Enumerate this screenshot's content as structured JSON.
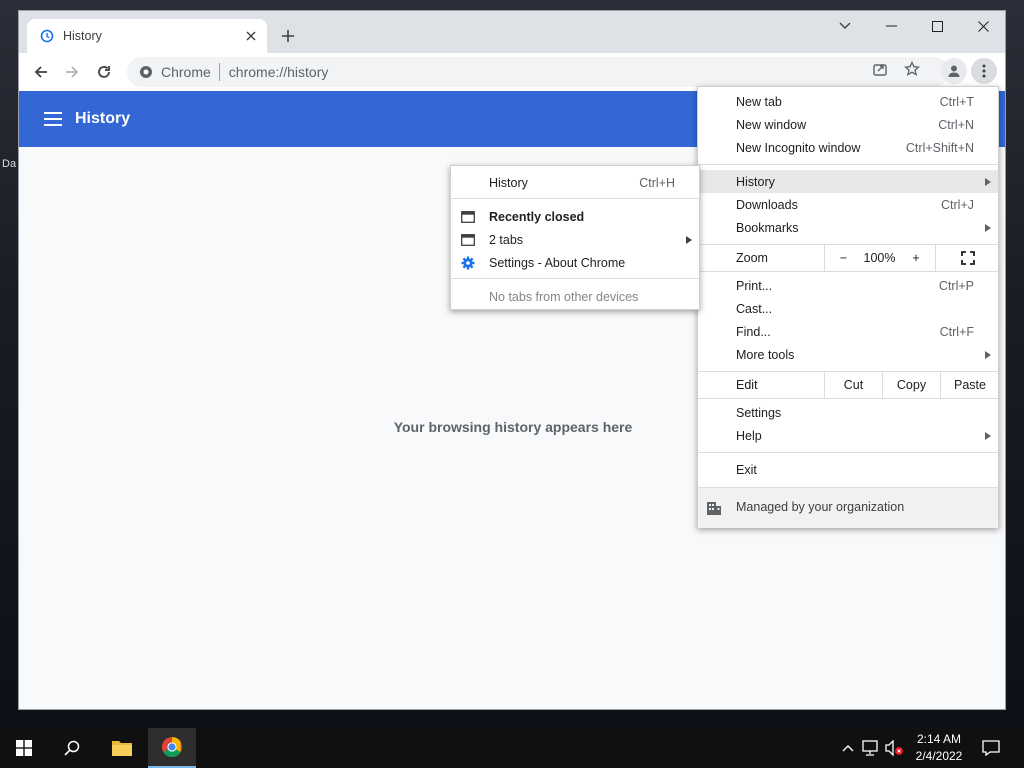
{
  "desktop": {
    "label_da": "Da"
  },
  "tab": {
    "title": "History"
  },
  "omnibox": {
    "chip": "Chrome",
    "url": "chrome://history"
  },
  "header": {
    "title": "History"
  },
  "empty": {
    "message": "Your browsing history appears here"
  },
  "main_menu": {
    "new_tab": {
      "label": "New tab",
      "shortcut": "Ctrl+T"
    },
    "new_window": {
      "label": "New window",
      "shortcut": "Ctrl+N"
    },
    "new_incognito": {
      "label": "New Incognito window",
      "shortcut": "Ctrl+Shift+N"
    },
    "history": {
      "label": "History"
    },
    "downloads": {
      "label": "Downloads",
      "shortcut": "Ctrl+J"
    },
    "bookmarks": {
      "label": "Bookmarks"
    },
    "zoom": {
      "label": "Zoom",
      "minus": "−",
      "value": "100%",
      "plus": "+"
    },
    "print": {
      "label": "Print...",
      "shortcut": "Ctrl+P"
    },
    "cast": {
      "label": "Cast..."
    },
    "find": {
      "label": "Find...",
      "shortcut": "Ctrl+F"
    },
    "more_tools": {
      "label": "More tools"
    },
    "edit": {
      "label": "Edit",
      "cut": "Cut",
      "copy": "Copy",
      "paste": "Paste"
    },
    "settings": {
      "label": "Settings"
    },
    "help": {
      "label": "Help"
    },
    "exit": {
      "label": "Exit"
    },
    "managed": {
      "label": "Managed by your organization"
    }
  },
  "history_submenu": {
    "history": {
      "label": "History",
      "shortcut": "Ctrl+H"
    },
    "recently_closed": {
      "label": "Recently closed"
    },
    "two_tabs": {
      "label": "2 tabs"
    },
    "settings_about": {
      "label": "Settings - About Chrome"
    },
    "no_tabs": {
      "label": "No tabs from other devices"
    }
  },
  "taskbar": {
    "time": "2:14 AM",
    "date": "2/4/2022"
  },
  "colors": {
    "accent": "#3367d6",
    "tab_strip": "#dee1e6",
    "page_bg": "#f8f9fa",
    "taskbar": "#101010"
  },
  "icons": [
    "history-icon",
    "close-icon",
    "plus-icon",
    "chevron-down-icon",
    "minimize-icon",
    "maximize-icon",
    "back-icon",
    "forward-icon",
    "reload-icon",
    "share-icon",
    "star-icon",
    "profile-icon",
    "kebab-menu-icon",
    "hamburger-icon",
    "tab-window-icon",
    "gear-icon",
    "building-icon",
    "windows-start-icon",
    "search-icon",
    "folder-icon",
    "chrome-icon",
    "caret-up-icon",
    "network-icon",
    "volume-muted-icon",
    "notification-icon"
  ]
}
